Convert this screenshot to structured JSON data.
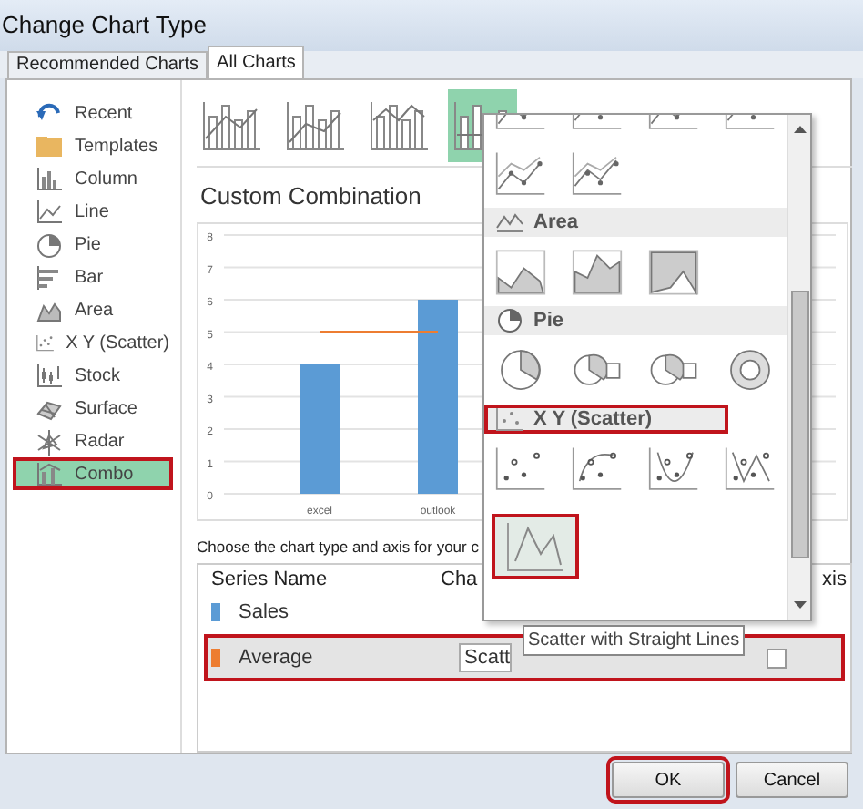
{
  "window": {
    "title": "Change Chart Type"
  },
  "tabs": [
    {
      "label": "Recommended Charts",
      "selected": false
    },
    {
      "label": "All Charts",
      "selected": true
    }
  ],
  "sidebar": {
    "items": [
      {
        "label": "Recent",
        "selected": false,
        "highlighted": false
      },
      {
        "label": "Templates",
        "selected": false,
        "highlighted": false
      },
      {
        "label": "Column",
        "selected": false,
        "highlighted": false
      },
      {
        "label": "Line",
        "selected": false,
        "highlighted": false
      },
      {
        "label": "Pie",
        "selected": false,
        "highlighted": false
      },
      {
        "label": "Bar",
        "selected": false,
        "highlighted": false
      },
      {
        "label": "Area",
        "selected": false,
        "highlighted": false
      },
      {
        "label": "X Y (Scatter)",
        "selected": false,
        "highlighted": false
      },
      {
        "label": "Stock",
        "selected": false,
        "highlighted": false
      },
      {
        "label": "Surface",
        "selected": false,
        "highlighted": false
      },
      {
        "label": "Radar",
        "selected": false,
        "highlighted": false
      },
      {
        "label": "Combo",
        "selected": true,
        "highlighted": true
      }
    ]
  },
  "subtypes": [
    {
      "selected": false
    },
    {
      "selected": false
    },
    {
      "selected": false
    },
    {
      "selected": true
    }
  ],
  "preview": {
    "heading": "Custom Combination",
    "chart_data": {
      "type": "bar",
      "categories": [
        "excel",
        "outlook"
      ],
      "series": [
        {
          "color": "#5b9bd5",
          "values": [
            4,
            6
          ]
        },
        {
          "color": "#ed7d31",
          "type": "line",
          "values": [
            5,
            5
          ]
        }
      ],
      "grid": true,
      "ylim": [
        0,
        8
      ],
      "yticks": [
        0,
        1,
        2,
        3,
        4,
        5,
        6,
        7,
        8
      ]
    }
  },
  "series_prompt": "Choose the chart type and axis for your c",
  "series_table": {
    "columns": [
      "Series Name",
      "Cha",
      "xis"
    ],
    "rows": [
      {
        "name": "Sales",
        "color": "#5b9bd5",
        "highlighted": false
      },
      {
        "name": "Average",
        "color": "#ed7d31",
        "chart_type": "Scatt",
        "secondary_axis": false,
        "highlighted": true
      }
    ]
  },
  "dropdown": {
    "sections": [
      {
        "kind": "line",
        "icons": [
          {
            "highlighted": false
          },
          {
            "highlighted": false
          },
          {
            "highlighted": false
          },
          {
            "highlighted": false
          },
          {
            "highlighted": false
          },
          {
            "highlighted": false
          }
        ]
      },
      {
        "kind": "area",
        "title": "Area",
        "highlighted": false,
        "icons": [
          {
            "highlighted": false
          },
          {
            "highlighted": false
          },
          {
            "highlighted": false
          }
        ]
      },
      {
        "kind": "pie",
        "title": "Pie",
        "highlighted": false,
        "icons": [
          {
            "highlighted": false
          },
          {
            "highlighted": false
          },
          {
            "highlighted": false
          },
          {
            "highlighted": false
          }
        ]
      },
      {
        "kind": "scatter",
        "title": "X Y (Scatter)",
        "highlighted": true,
        "icons": [
          {
            "highlighted": false
          },
          {
            "highlighted": false
          },
          {
            "highlighted": false
          },
          {
            "highlighted": false
          },
          {
            "highlighted": true
          }
        ]
      }
    ]
  },
  "tooltip": "Scatter with Straight Lines",
  "buttons": [
    {
      "label": "OK",
      "highlighted": true
    },
    {
      "label": "Cancel",
      "highlighted": false
    }
  ]
}
